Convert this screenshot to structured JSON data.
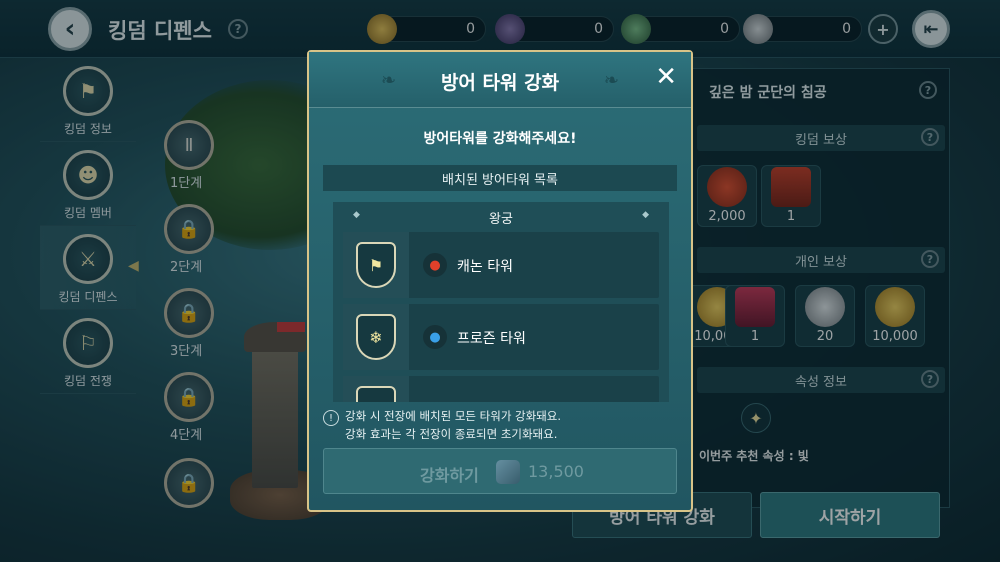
{
  "topbar": {
    "back_icon": "back-arrow-icon",
    "title": "킹덤 디펜스",
    "help": "?",
    "currencies": [
      {
        "name": "kingdom-coin",
        "value": "0",
        "color": "#b8953a"
      },
      {
        "name": "dark-crystal",
        "value": "0",
        "color": "#6a5a8a"
      },
      {
        "name": "green-crystal",
        "value": "0",
        "color": "#4f8a5a"
      },
      {
        "name": "silver-coin",
        "value": "0",
        "color": "#9aa0a4"
      }
    ],
    "add_icon": "plus-icon",
    "exit_icon": "exit-door-icon"
  },
  "sidebar": {
    "items": [
      {
        "label": "킹덤 정보",
        "icon": "shield-banner-icon"
      },
      {
        "label": "킹덤 멤버",
        "icon": "members-icon"
      },
      {
        "label": "킹덤 디펜스",
        "icon": "crossed-swords-icon"
      },
      {
        "label": "킹덤 전쟁",
        "icon": "crossed-flags-icon"
      }
    ]
  },
  "stages": [
    {
      "label": "1단계",
      "icon": "sword-icon"
    },
    {
      "label": "2단계",
      "icon": "lock-icon"
    },
    {
      "label": "3단계",
      "icon": "lock-icon"
    },
    {
      "label": "4단계",
      "icon": "lock-icon"
    },
    {
      "label": "",
      "icon": "lock-icon"
    }
  ],
  "right_panel": {
    "event_title": "깊은 밤 군단의 침공",
    "help": "?",
    "kingdom_reward_header": "킹덤 보상",
    "kingdom_rewards": [
      {
        "name": "exp",
        "value": "2,000"
      },
      {
        "name": "mystery-chest",
        "value": "1"
      }
    ],
    "personal_reward_header": "개인 보상",
    "personal_rewards": [
      {
        "name": "gold-coin",
        "value": "10,000"
      },
      {
        "name": "red-chest",
        "value": "1"
      },
      {
        "name": "silver-coin",
        "value": "20"
      },
      {
        "name": "gold-coin",
        "value": "10,000"
      }
    ],
    "attribute_header": "속성 정보",
    "attribute_text": "이번주 추천 속성 : 빛",
    "defense_upgrade_button": "방어 타워 강화",
    "start_button": "시작하기"
  },
  "dialog": {
    "title": "방어 타워 강화",
    "close": "✕",
    "subtitle": "방어타워를 강화해주세요!",
    "list_header": "배치된 방어타워 목록",
    "group_title": "왕궁",
    "towers": [
      {
        "name": "캐논 타워",
        "element": "fire-element-icon",
        "element_color": "#e0402a"
      },
      {
        "name": "프로즌 타워",
        "element": "water-element-icon",
        "element_color": "#3aa0e8"
      }
    ],
    "notice_lines": [
      "강화 시 전장에 배치된 모든 타워가 강화돼요.",
      "강화 효과는 각 전장이 종료되면 초기화돼요."
    ],
    "notice_icon": "!",
    "upgrade_button": "강화하기",
    "upgrade_cost": "13,500"
  }
}
